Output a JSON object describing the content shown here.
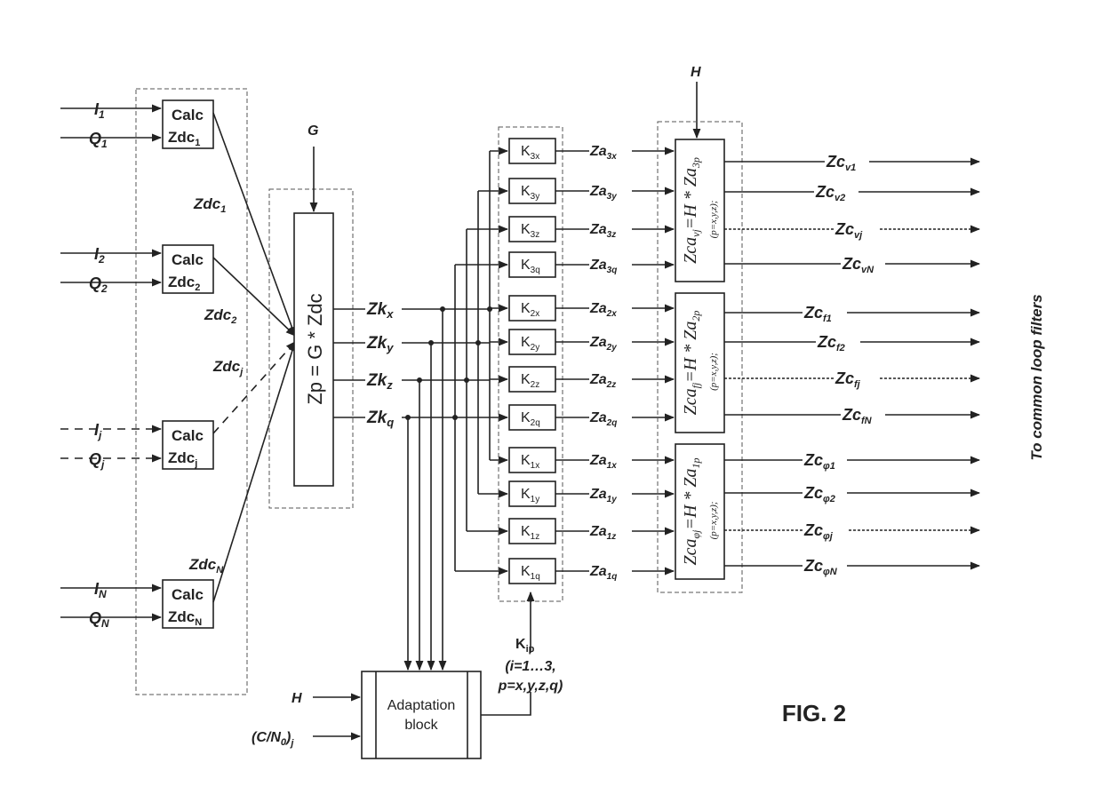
{
  "figure_label": "FIG. 2",
  "side_label": "To common loop filters",
  "inputs": [
    {
      "i": "I",
      "i_sub": "1",
      "q": "Q",
      "q_sub": "1",
      "calc_line1": "Calc",
      "calc_line2": "Zdc",
      "calc_sub": "1",
      "out": "Zdc",
      "out_sub": "1",
      "dashed": false
    },
    {
      "i": "I",
      "i_sub": "2",
      "q": "Q",
      "q_sub": "2",
      "calc_line1": "Calc",
      "calc_line2": "Zdc",
      "calc_sub": "2",
      "out": "Zdc",
      "out_sub": "2",
      "dashed": false
    },
    {
      "i": "I",
      "i_sub": "j",
      "q": "Q",
      "q_sub": "j",
      "calc_line1": "Calc",
      "calc_line2": "Zdc",
      "calc_sub": "j",
      "out": "Zdc",
      "out_sub": "j",
      "dashed": true
    },
    {
      "i": "I",
      "i_sub": "N",
      "q": "Q",
      "q_sub": "N",
      "calc_line1": "Calc",
      "calc_line2": "Zdc",
      "calc_sub": "N",
      "out": "Zdc",
      "out_sub": "N",
      "dashed": false
    }
  ],
  "projection": {
    "gain_label": "G",
    "formula": "Zp = G * Zdc"
  },
  "zk": [
    {
      "base": "Zk",
      "sub": "x"
    },
    {
      "base": "Zk",
      "sub": "y"
    },
    {
      "base": "Zk",
      "sub": "z"
    },
    {
      "base": "Zk",
      "sub": "q"
    }
  ],
  "gain_rows": [
    {
      "k": "K",
      "k_sub": "3x",
      "za": "Za",
      "za_sub": "3x"
    },
    {
      "k": "K",
      "k_sub": "3y",
      "za": "Za",
      "za_sub": "3y"
    },
    {
      "k": "K",
      "k_sub": "3z",
      "za": "Za",
      "za_sub": "3z"
    },
    {
      "k": "K",
      "k_sub": "3q",
      "za": "Za",
      "za_sub": "3q"
    },
    {
      "k": "K",
      "k_sub": "2x",
      "za": "Za",
      "za_sub": "2x"
    },
    {
      "k": "K",
      "k_sub": "2y",
      "za": "Za",
      "za_sub": "2y"
    },
    {
      "k": "K",
      "k_sub": "2z",
      "za": "Za",
      "za_sub": "2z"
    },
    {
      "k": "K",
      "k_sub": "2q",
      "za": "Za",
      "za_sub": "2q"
    },
    {
      "k": "K",
      "k_sub": "1x",
      "za": "Za",
      "za_sub": "1x"
    },
    {
      "k": "K",
      "k_sub": "1y",
      "za": "Za",
      "za_sub": "1y"
    },
    {
      "k": "K",
      "k_sub": "1z",
      "za": "Za",
      "za_sub": "1z"
    },
    {
      "k": "K",
      "k_sub": "1q",
      "za": "Za",
      "za_sub": "1q"
    }
  ],
  "combiner": {
    "h_label": "H",
    "blocks": [
      {
        "lhs": "Zca",
        "lhs_sub": "vj",
        "rhs": "=H * Za",
        "rhs_sub": "3p",
        "note": "(p=x,y,z);",
        "outputs": [
          {
            "base": "Zc",
            "sub": "v1",
            "dashed": false
          },
          {
            "base": "Zc",
            "sub": "v2",
            "dashed": false
          },
          {
            "base": "Zc",
            "sub": "vj",
            "dashed": true
          },
          {
            "base": "Zc",
            "sub": "vN",
            "dashed": false
          }
        ]
      },
      {
        "lhs": "Zca",
        "lhs_sub": "fj",
        "rhs": "=H * Za",
        "rhs_sub": "2p",
        "note": "(p=x,y,z);",
        "outputs": [
          {
            "base": "Zc",
            "sub": "f1",
            "dashed": false
          },
          {
            "base": "Zc",
            "sub": "f2",
            "dashed": false
          },
          {
            "base": "Zc",
            "sub": "fj",
            "dashed": true
          },
          {
            "base": "Zc",
            "sub": "fN",
            "dashed": false
          }
        ]
      },
      {
        "lhs": "Zca",
        "lhs_sub": "φj",
        "rhs": "=H * Za",
        "rhs_sub": "1p",
        "note": "(p=x,y,z);",
        "outputs": [
          {
            "base": "Zc",
            "sub": "φ1",
            "dashed": false
          },
          {
            "base": "Zc",
            "sub": "φ2",
            "dashed": false
          },
          {
            "base": "Zc",
            "sub": "φj",
            "dashed": true
          },
          {
            "base": "Zc",
            "sub": "φN",
            "dashed": false
          }
        ]
      }
    ]
  },
  "adaptation": {
    "line1": "Adaptation",
    "line2": "block",
    "input_h": "H",
    "input_cn": "(C/N",
    "input_cn_sub": "0",
    "input_cn_close": ")",
    "input_cn_sub2": "j",
    "kip": "K",
    "kip_sub": "ip",
    "kip_range1": "(i=1…3,",
    "kip_range2": "p=x,y,z,q)"
  }
}
